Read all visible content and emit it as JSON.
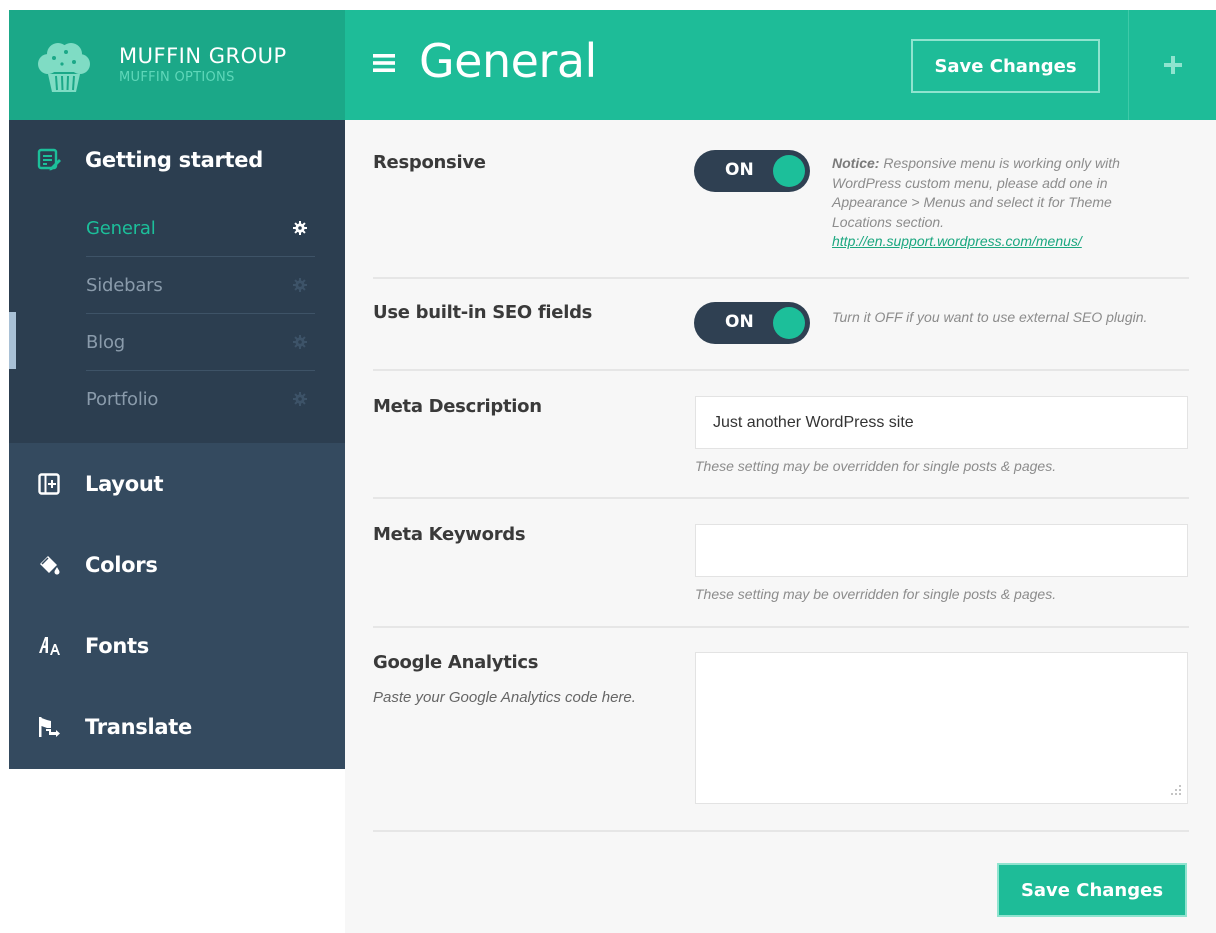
{
  "brand": {
    "title": "MUFFIN GROUP",
    "subtitle": "MUFFIN OPTIONS"
  },
  "sidebar": {
    "getting_started": {
      "label": "Getting started",
      "items": [
        {
          "label": "General",
          "active": true
        },
        {
          "label": "Sidebars",
          "active": false
        },
        {
          "label": "Blog",
          "active": false
        },
        {
          "label": "Portfolio",
          "active": false
        }
      ]
    },
    "sections": [
      {
        "label": "Layout",
        "icon": "layout-icon"
      },
      {
        "label": "Colors",
        "icon": "paint-bucket-icon"
      },
      {
        "label": "Fonts",
        "icon": "font-icon"
      },
      {
        "label": "Translate",
        "icon": "flag-icon"
      }
    ]
  },
  "header": {
    "title": "General",
    "save_label": "Save Changes"
  },
  "settings": {
    "responsive": {
      "label": "Responsive",
      "toggle": "ON",
      "notice_bold": "Notice:",
      "notice_text": " Responsive menu is working only with WordPress custom menu, please add one in Appearance > Menus and select it for Theme Locations section.",
      "notice_link": "http://en.support.wordpress.com/menus/"
    },
    "seo": {
      "label": "Use built-in SEO fields",
      "toggle": "ON",
      "note": "Turn it OFF if you want to use external SEO plugin."
    },
    "meta_description": {
      "label": "Meta Description",
      "value": "Just another WordPress site",
      "hint": "These setting may be overridden for single posts & pages."
    },
    "meta_keywords": {
      "label": "Meta Keywords",
      "value": "",
      "hint": "These setting may be overridden for single posts & pages."
    },
    "google_analytics": {
      "label": "Google Analytics",
      "desc": "Paste your Google Analytics code here.",
      "value": ""
    }
  },
  "footer": {
    "save_label": "Save Changes"
  },
  "colors": {
    "accent": "#1ebc98",
    "brand": "#1ba888",
    "sidebar": "#344a5f",
    "sidebar_open": "#2c3e50",
    "toggle_bg": "#2f4052"
  }
}
